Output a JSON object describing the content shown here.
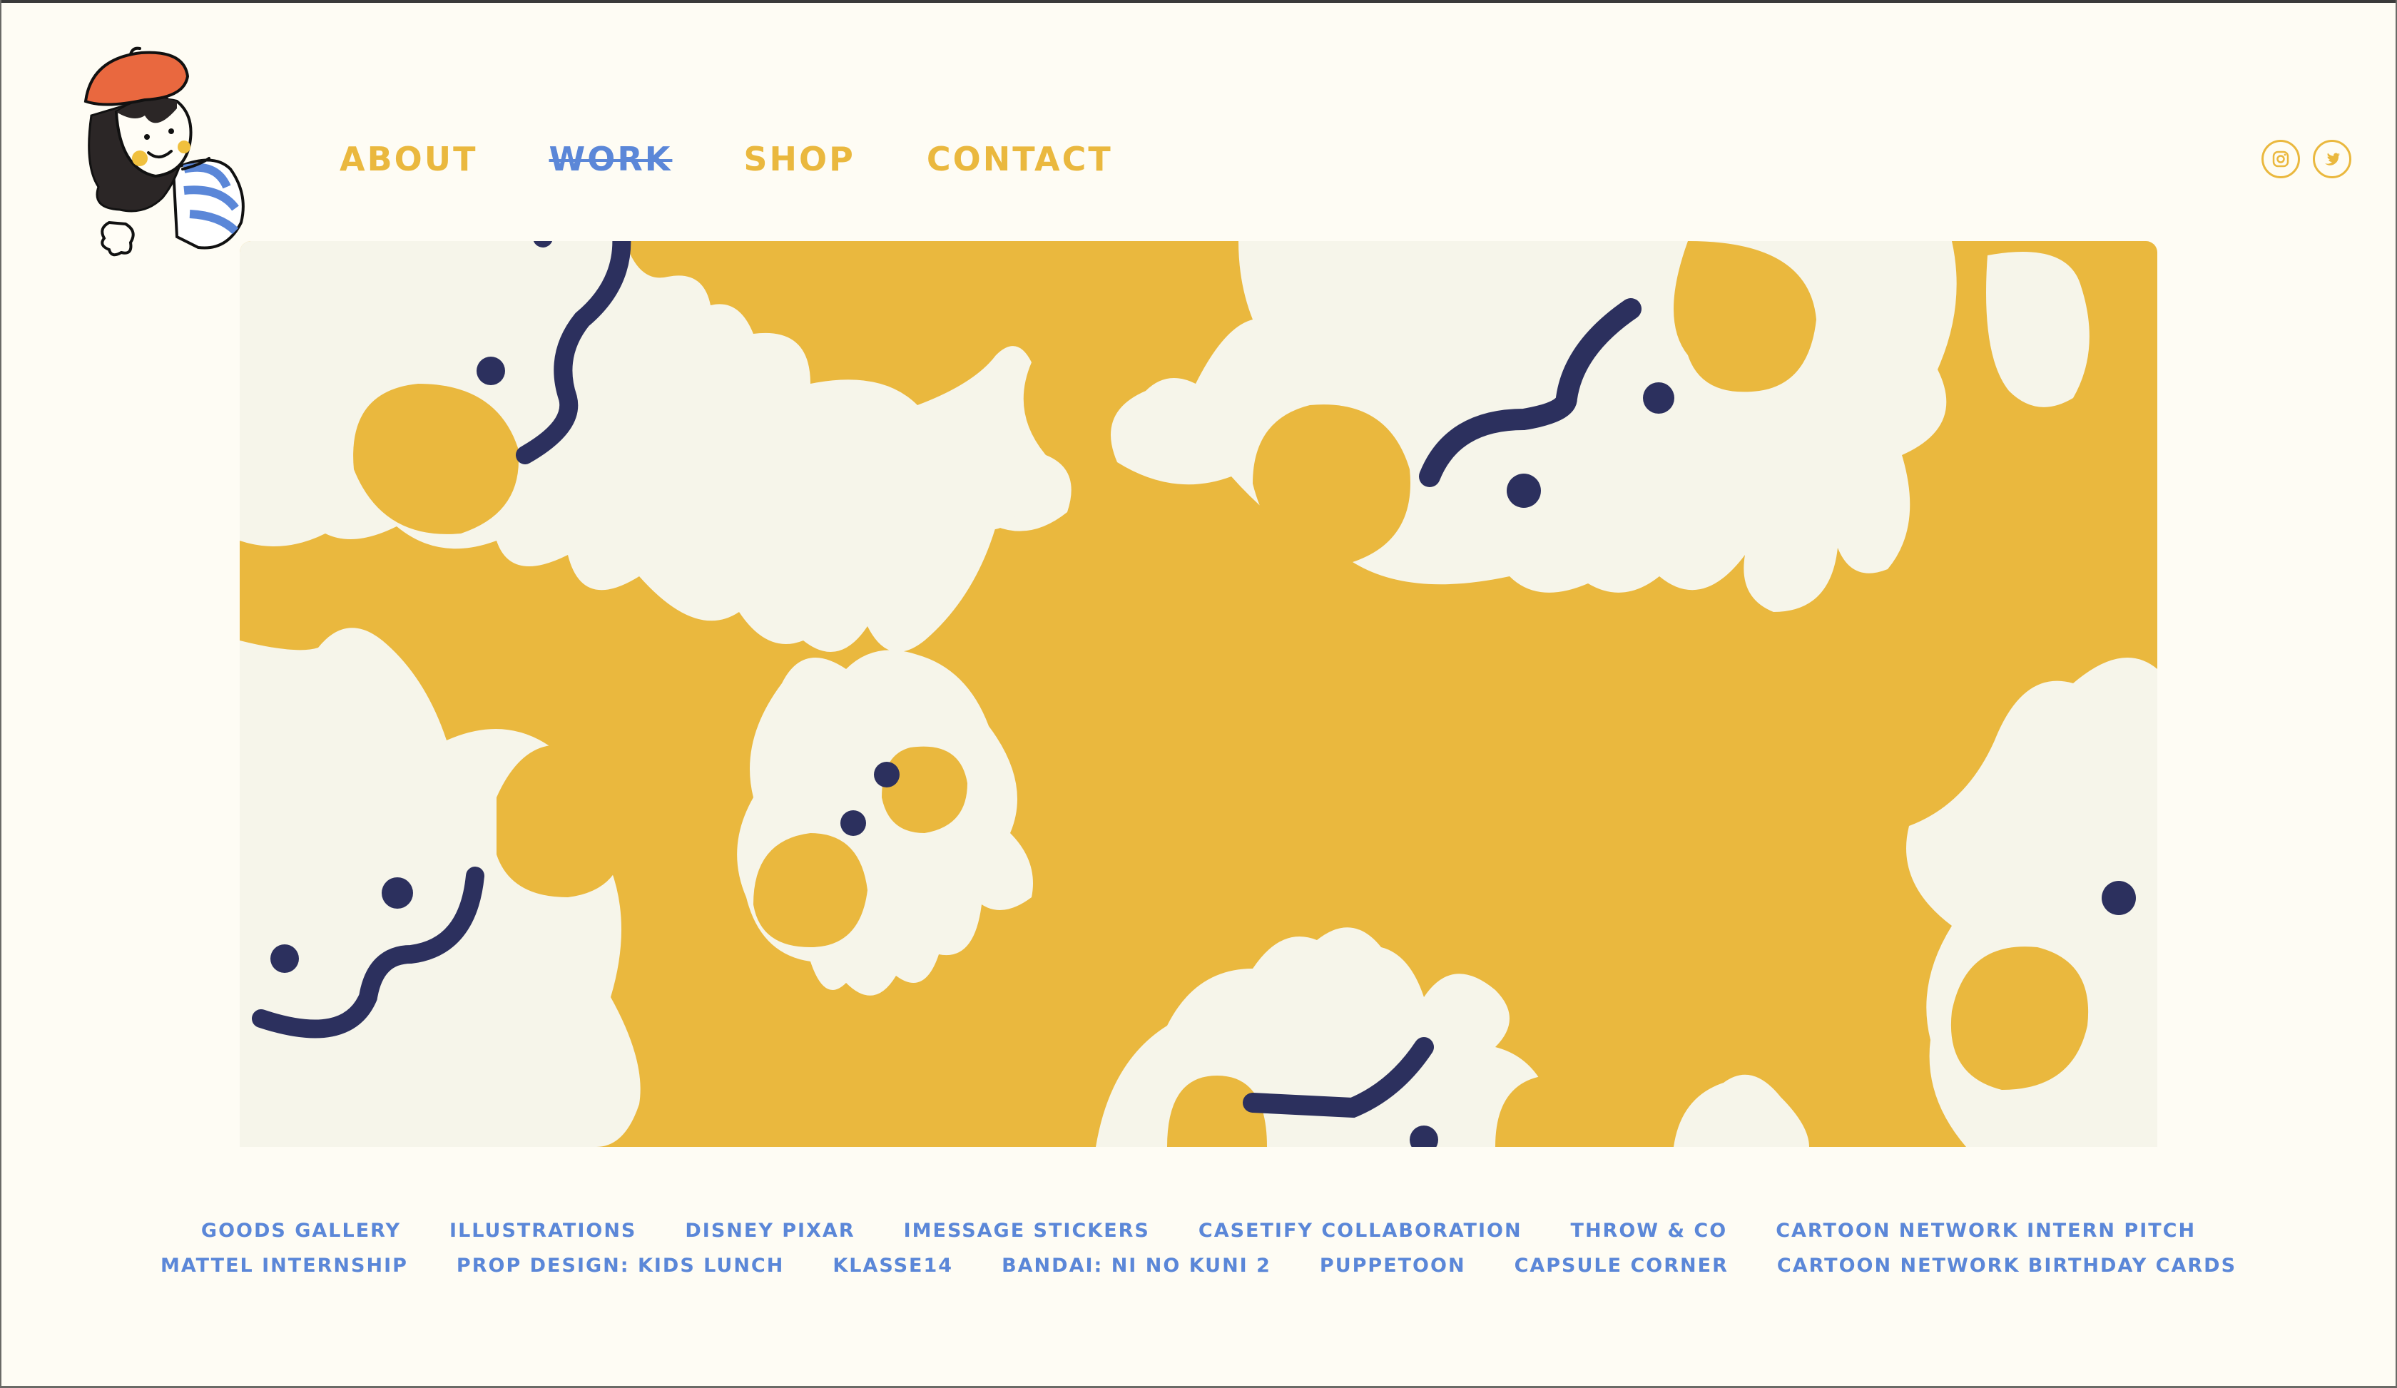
{
  "colors": {
    "accent_yellow": "#eab83e",
    "accent_blue": "#5b87d8",
    "cream": "#f6f5ea",
    "navy": "#2c305e",
    "background": "#fefcf4"
  },
  "logo": {
    "icon": "girl-with-beret-logo"
  },
  "nav": {
    "items": [
      {
        "label": "ABOUT",
        "color": "#eab83e"
      },
      {
        "label": "WORK",
        "color": "#5b87d8"
      },
      {
        "label": "SHOP",
        "color": "#eab83e"
      },
      {
        "label": "CONTACT",
        "color": "#eab83e"
      }
    ],
    "active": "WORK"
  },
  "social": [
    {
      "icon": "instagram-icon"
    },
    {
      "icon": "twitter-icon"
    }
  ],
  "hero": {
    "icon": "cream-elephant-pattern-banner"
  },
  "projects": {
    "row1": [
      "GOODS GALLERY",
      "ILLUSTRATIONS",
      "DISNEY PIXAR",
      "IMESSAGE STICKERS",
      "CASETIFY COLLABORATION",
      "THROW & CO",
      "CARTOON NETWORK INTERN PITCH"
    ],
    "row2": [
      "MATTEL INTERNSHIP",
      "PROP DESIGN: KIDS LUNCH",
      "KLASSE14",
      "BANDAI: NI NO KUNI 2",
      "PUPPETOON",
      "CAPSULE CORNER",
      "CARTOON NETWORK BIRTHDAY CARDS"
    ]
  }
}
